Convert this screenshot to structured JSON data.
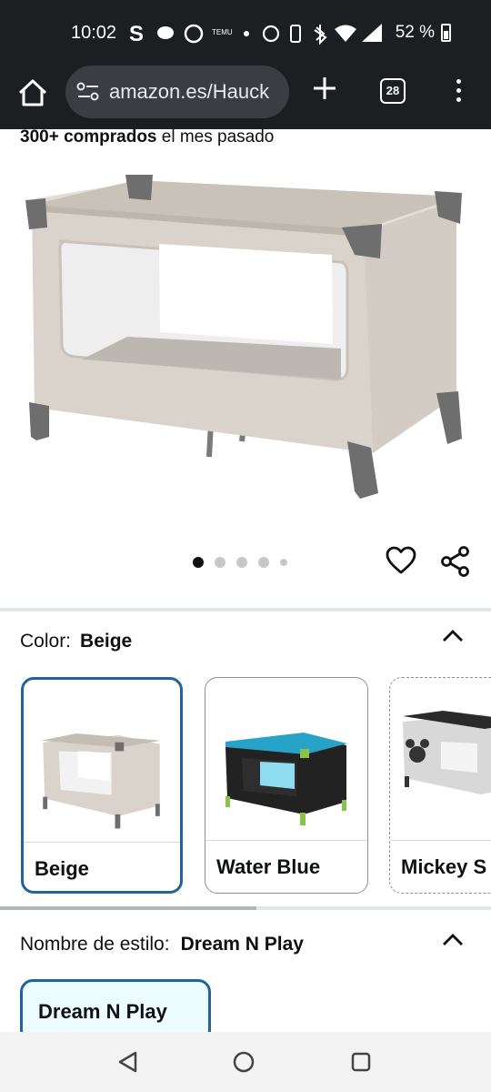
{
  "status_bar": {
    "time": "10:02",
    "icons": [
      "skype-icon",
      "chat-icon",
      "whatsapp-icon",
      "temu-icon",
      "dot",
      "alarm-icon",
      "vibrate-icon",
      "bluetooth-icon",
      "wifi-icon",
      "signal-icon"
    ],
    "battery_text": "52 %"
  },
  "browser": {
    "url": "amazon.es/Hauck",
    "tab_count": "28"
  },
  "product": {
    "bought_count": "300+ comprados",
    "bought_suffix": " el mes pasado",
    "image_count": 5,
    "active_image": 1
  },
  "color_section": {
    "label": "Color:",
    "selected": "Beige",
    "options": [
      {
        "label": "Beige",
        "selected": true,
        "frame": "#8f8a84",
        "fabric": "#d9d3cb"
      },
      {
        "label": "Water Blue",
        "selected": false,
        "frame": "#222222",
        "fabric": "#27a3c8"
      },
      {
        "label": "Mickey S",
        "selected": false,
        "frame": "#2a2a2a",
        "fabric": "#d8d8d8"
      }
    ]
  },
  "style_section": {
    "label": "Nombre de estilo:",
    "selected": "Dream N Play",
    "options": [
      {
        "label": "Dream N Play",
        "selected": true
      }
    ]
  },
  "colors": {
    "accent": "#2162a1",
    "browser_chrome": "#1c1f22",
    "beige_fabric": "#d9d3cb"
  }
}
